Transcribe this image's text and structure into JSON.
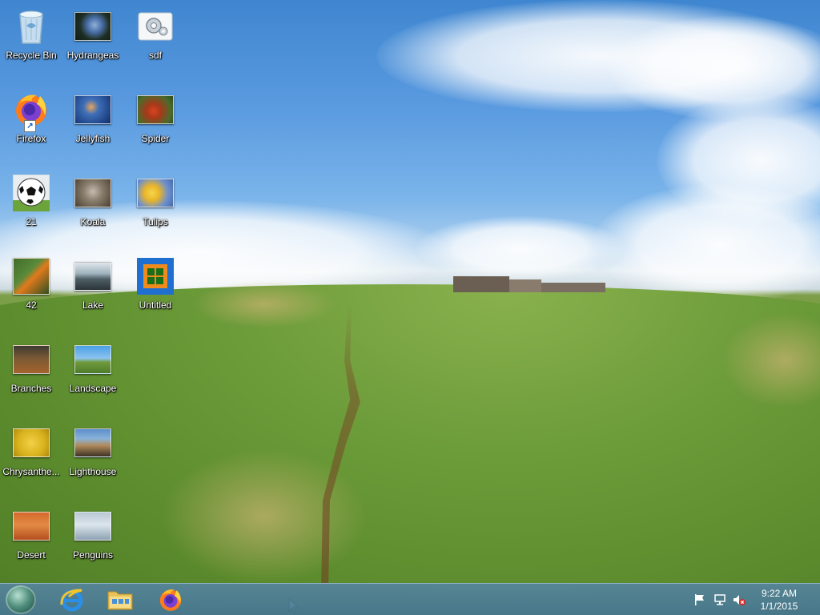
{
  "desktop": {
    "icons": [
      {
        "label": "Recycle Bin",
        "icon": "recycle-bin-icon"
      },
      {
        "label": "Hydrangeas",
        "icon": "image-file-icon"
      },
      {
        "label": "sdf",
        "icon": "settings-file-icon"
      },
      {
        "label": "Firefox",
        "icon": "firefox-icon",
        "shortcut": true
      },
      {
        "label": "Jellyfish",
        "icon": "image-file-icon"
      },
      {
        "label": "Spider",
        "icon": "image-file-icon"
      },
      {
        "label": "21",
        "icon": "soccer-ball-icon"
      },
      {
        "label": "Koala",
        "icon": "image-file-icon"
      },
      {
        "label": "Tulips",
        "icon": "image-file-icon"
      },
      {
        "label": "42",
        "icon": "image-file-icon"
      },
      {
        "label": "Lake",
        "icon": "image-file-icon"
      },
      {
        "label": "Untitled",
        "icon": "untitled-app-icon"
      },
      {
        "label": "Branches",
        "icon": "image-file-icon"
      },
      {
        "label": "Landscape",
        "icon": "image-file-icon"
      },
      {
        "label": "Chrysanthe...",
        "icon": "image-file-icon"
      },
      {
        "label": "Lighthouse",
        "icon": "image-file-icon"
      },
      {
        "label": "Desert",
        "icon": "image-file-icon"
      },
      {
        "label": "Penguins",
        "icon": "image-file-icon"
      }
    ]
  },
  "taskbar": {
    "pinned": [
      {
        "name": "internet-explorer",
        "icon": "internet-explorer-icon"
      },
      {
        "name": "file-explorer",
        "icon": "folder-icon"
      },
      {
        "name": "firefox",
        "icon": "firefox-icon"
      }
    ],
    "tray": {
      "icons": [
        "flag-icon",
        "network-icon",
        "volume-muted-icon"
      ],
      "time": "9:22 AM",
      "date": "1/1/2015"
    }
  },
  "colors": {
    "taskbar": "#4f7f97",
    "sky": "#5b9be0",
    "grass": "#6f9a3c"
  }
}
